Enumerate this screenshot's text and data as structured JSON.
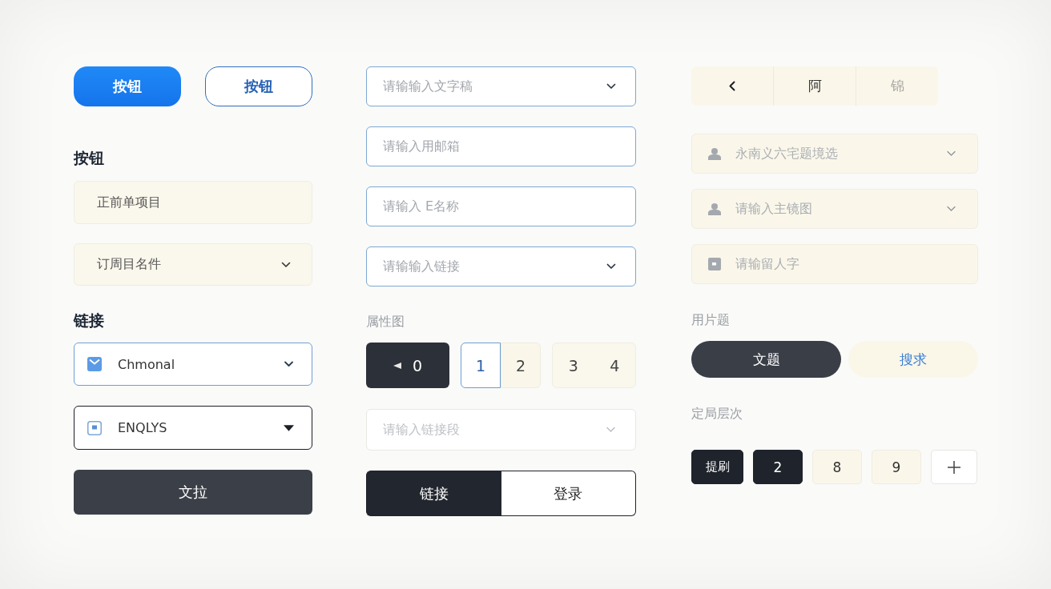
{
  "left_column": {
    "buttons": [
      {
        "kind": "primary",
        "label": "按钮"
      },
      {
        "kind": "outline",
        "label": "按钮"
      }
    ],
    "heading_1": "按钮",
    "text_field": {
      "value": "正前单项目"
    },
    "dropdown": {
      "value": "订周目名件"
    },
    "heading_2": "链接",
    "selects": [
      {
        "kind": "accent",
        "value": "Chmonal"
      },
      {
        "kind": "dark",
        "value": "ENQLYS"
      }
    ],
    "submit_button": "文拉"
  },
  "middle_column": {
    "fields": [
      {
        "kind": "select",
        "placeholder": "请输输入文字稿"
      },
      {
        "kind": "input",
        "placeholder": "请输入用邮箱"
      },
      {
        "kind": "input",
        "placeholder": "请输入 E名称"
      },
      {
        "kind": "select",
        "placeholder": "请输输入链接"
      }
    ],
    "label": "属性图",
    "counter": {
      "value": "0"
    },
    "pair_toggle": [
      {
        "label": "1",
        "selected": true
      },
      {
        "label": "2",
        "selected": false
      }
    ],
    "number_group": [
      "3",
      "4"
    ],
    "disabled_select": {
      "placeholder": "请输入链接段",
      "disabled": true
    },
    "switch": [
      {
        "label": "链接",
        "selected": true
      },
      {
        "label": "登录",
        "selected": false
      }
    ]
  },
  "right_column": {
    "pager": [
      {
        "kind": "prev",
        "disabled": false
      },
      {
        "kind": "page",
        "label": "阿",
        "disabled": false
      },
      {
        "kind": "page",
        "label": "锦",
        "disabled": true
      }
    ],
    "fields": [
      {
        "kind": "select",
        "placeholder": "永南义六宅题境选"
      },
      {
        "kind": "select",
        "placeholder": "请输入主镜图"
      },
      {
        "kind": "input",
        "placeholder": "请输留人字"
      }
    ],
    "label_1": "用片题",
    "pills": [
      {
        "label": "文题",
        "selected": true
      },
      {
        "label": "搜求",
        "selected": false
      }
    ],
    "label_2": "定局层次",
    "pages": [
      {
        "kind": "text",
        "label": "提刷",
        "selected": true
      },
      {
        "kind": "number",
        "label": "2",
        "selected": true
      },
      {
        "kind": "number",
        "label": "8",
        "selected": false
      },
      {
        "kind": "number",
        "label": "9",
        "selected": false
      },
      {
        "kind": "add",
        "selected": false
      }
    ]
  }
}
